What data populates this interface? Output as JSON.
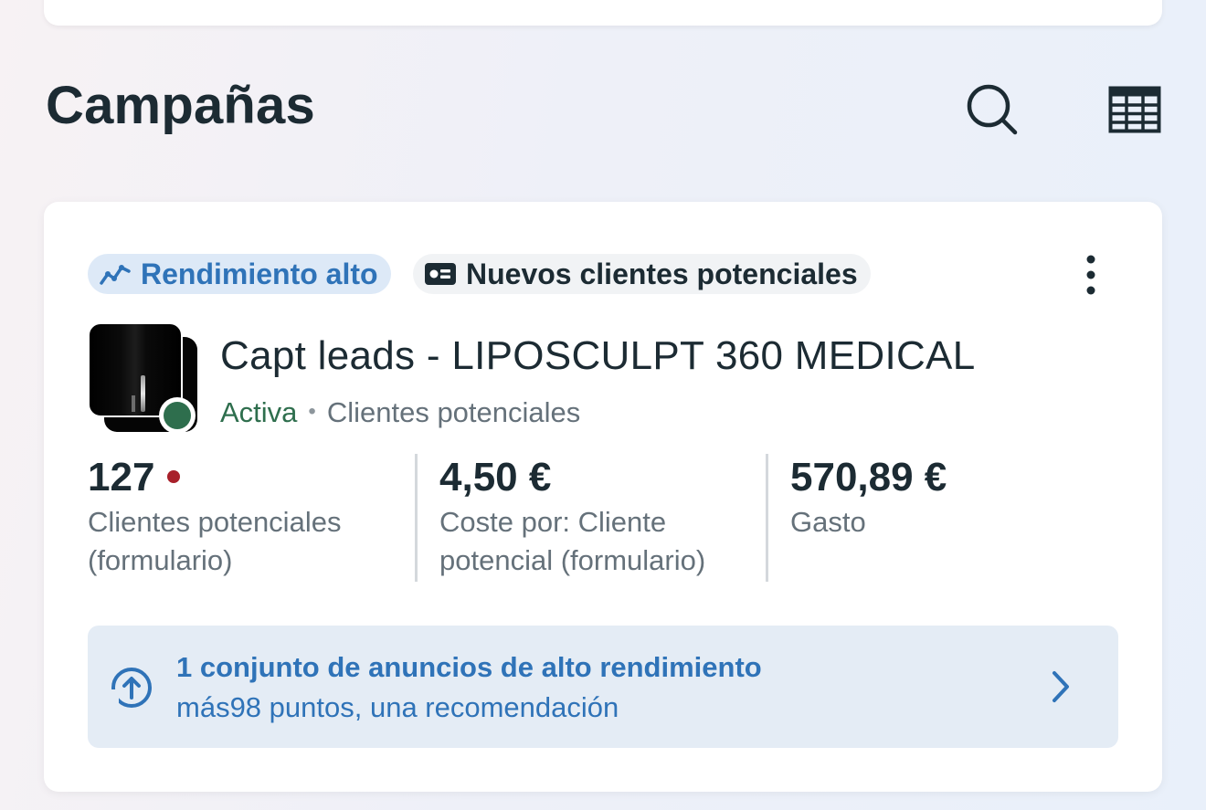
{
  "section": {
    "title": "Campañas",
    "search_icon": "search-icon",
    "table_icon": "table-icon"
  },
  "campaign": {
    "chips": {
      "performance": "Rendimiento alto",
      "objective": "Nuevos clientes potenciales"
    },
    "name": "Capt leads - LIPOSCULPT 360 MEDICAL",
    "status": "Activa",
    "separator": "•",
    "result_type": "Clientes potenciales",
    "status_color": "#2e6e4d",
    "metrics": [
      {
        "value": "127",
        "label_line1": "Clientes potenciales",
        "label_line2": "(formulario)",
        "alert_color": "#a8202a"
      },
      {
        "value": "4,50 €",
        "label_line1": "Coste por: Cliente",
        "label_line2": "potencial (formulario)"
      },
      {
        "value": "570,89 €",
        "label_line1": "Gasto",
        "label_line2": ""
      }
    ],
    "recommendation": {
      "title": "1 conjunto de anuncios de alto rendimiento",
      "subtitle": "más98 puntos, una recomendación",
      "accent_color": "#2f73b8"
    }
  }
}
